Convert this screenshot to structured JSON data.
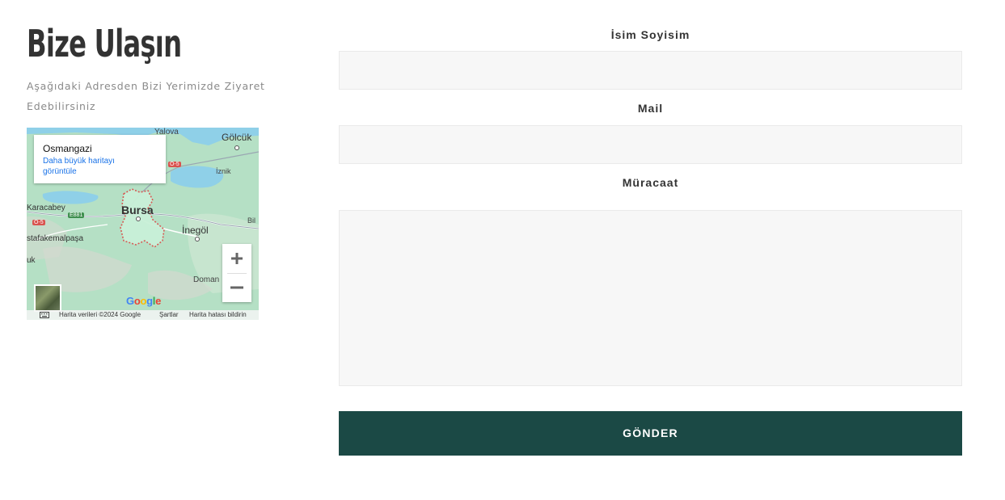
{
  "heading": {
    "title": "Bize Ulaşın",
    "subtitle": "Aşağıdaki Adresden Bizi Yerimizde Ziyaret Edebilirsiniz"
  },
  "map": {
    "place_name": "Osmangazi",
    "larger_map_link": "Daha büyük haritayı görüntüle",
    "labels": {
      "yalova": "Yalova",
      "golcuk": "Gölcük",
      "iznik": "İznik",
      "karacabey": "Karacabey",
      "bursa": "Bursa",
      "inegol": "İnegöl",
      "mustafakemalpasa": "stafakemalpaşa",
      "uk": "uk",
      "domanic": "Doman",
      "bil": "Bil",
      "road_o5_a": "O-5",
      "road_o5_b": "O-5",
      "road_e881": "E881"
    },
    "zoom_in": "+",
    "zoom_out": "−",
    "google_logo": "Google",
    "attribution": {
      "data": "Harita verileri ©2024 Google",
      "terms": "Şartlar",
      "report": "Harita hatası bildirin"
    },
    "icons": {
      "keyboard": "keyboard-icon"
    },
    "colors": {
      "land": "#a8dcbf",
      "water": "#8fd0e8",
      "boundary": "#d9534f"
    }
  },
  "form": {
    "name_label": "İsim Soyisim",
    "name_value": "",
    "mail_label": "Mail",
    "mail_value": "",
    "message_label": "Müracaat",
    "message_value": "",
    "submit_label": "GÖNDER",
    "button_color": "#1b4945"
  }
}
